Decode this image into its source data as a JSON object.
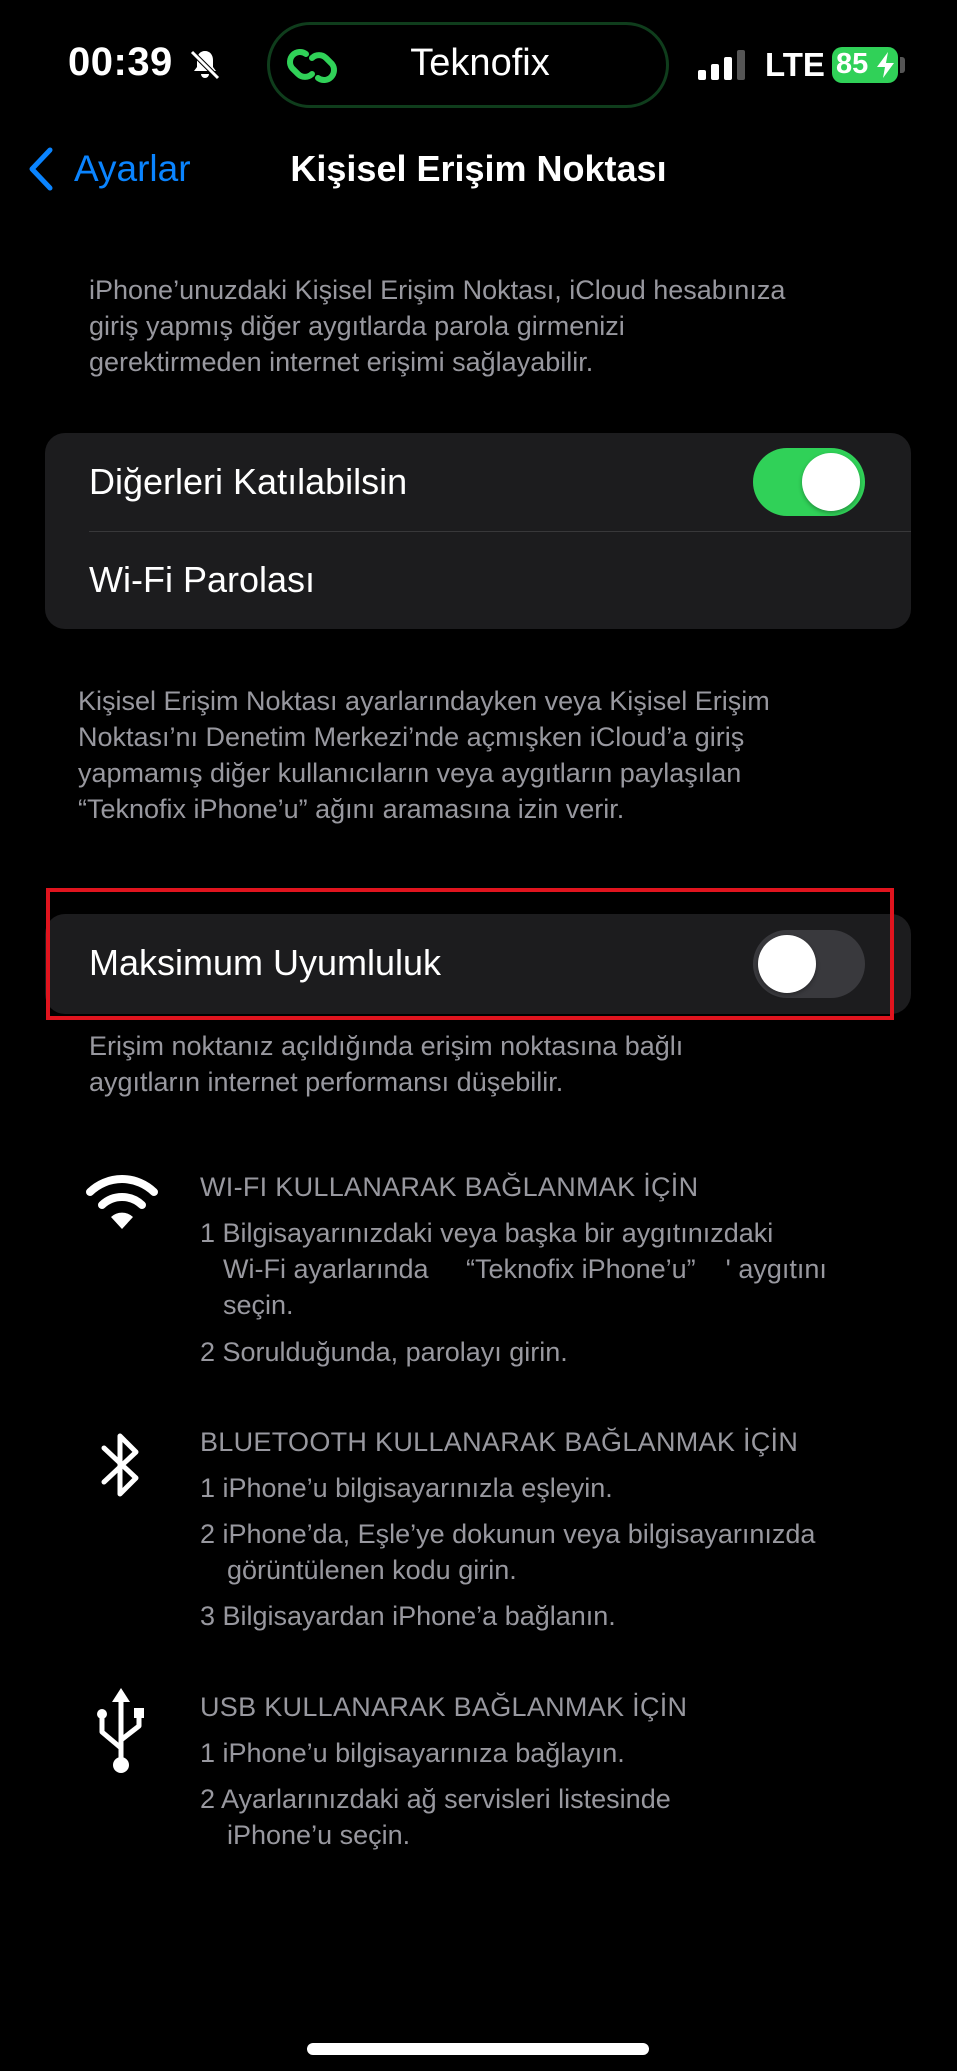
{
  "status": {
    "time": "00:39",
    "island_label": "Teknofix",
    "network": "LTE",
    "battery": "85"
  },
  "nav": {
    "back_label": "Ayarlar",
    "title": "Kişisel Erişim Noktası"
  },
  "intro_text": [
    "iPhone’unuzdaki Kişisel Erişim Noktası, iCloud hesabınıza",
    "giriş yapmış diğer aygıtlarda parola girmenizi",
    "gerektirmeden internet erişimi sağlayabilir."
  ],
  "group1": {
    "allow_others_label": "Diğerleri Katılabilsin",
    "allow_others_on": true,
    "wifi_password_label": "Wi-Fi Parolası"
  },
  "group1_footer": [
    "Kişisel Erişim Noktası ayarlarındayken veya Kişisel Erişim",
    "Noktası’nı Denetim Merkezi’nde açmışken iCloud’a giriş",
    "yapmamış diğer kullanıcıların veya aygıtların paylaşılan",
    "“Teknofix iPhone’u” ağını aramasına izin verir."
  ],
  "group2": {
    "max_compat_label": "Maksimum Uyumluluk",
    "max_compat_on": false
  },
  "group2_footer": [
    "Erişim noktanız açıldığında erişim noktasına bağlı",
    "aygıtların internet performansı düşebilir."
  ],
  "instructions": {
    "wifi": {
      "heading": "WI-FI KULLANARAK BAĞLANMAK İÇİN",
      "steps": [
        "1 Bilgisayarınızdaki veya başka bir aygıtınızdaki",
        "Wi-Fi ayarlarında     “Teknofix iPhone’u”    ' aygıtını",
        "seçin.",
        "2 Sorulduğunda, parolayı girin."
      ]
    },
    "bluetooth": {
      "heading": "BLUETOOTH KULLANARAK BAĞLANMAK İÇİN",
      "steps": [
        "1 iPhone’u bilgisayarınızla eşleyin.",
        "2 iPhone’da, Eşle’ye dokunun veya bilgisayarınızda",
        "görüntülenen kodu girin.",
        "3 Bilgisayardan iPhone’a bağlanın."
      ]
    },
    "usb": {
      "heading": "USB KULLANARAK BAĞLANMAK İÇİN",
      "steps": [
        "1 iPhone’u bilgisayarınıza bağlayın.",
        "2 Ayarlarınızdaki ağ servisleri listesinde",
        "iPhone’u seçin."
      ]
    }
  },
  "colors": {
    "accent": "#0a84ff",
    "toggle_on": "#30d158",
    "highlight": "#e0141e"
  }
}
